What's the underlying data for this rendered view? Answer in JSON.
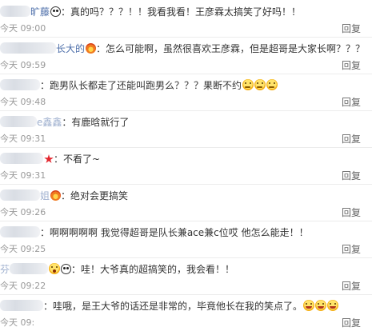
{
  "comments": [
    {
      "name": "旷藤",
      "text": "真的吗？？？！！我看我看！王彦霖太搞笑了好吗！！",
      "time": "今天 09:00",
      "reply": "回复",
      "emoji": [
        "panda-face"
      ]
    },
    {
      "name": "长大的",
      "text": "怎么可能啊，虽然很喜欢王彦霖，但是超哥是大家长啊？？？",
      "time": "今天 09:59",
      "reply": "回复",
      "emoji": [
        "fire-badge"
      ]
    },
    {
      "name": "",
      "text": "跑男队长都走了还能叫跑男么？？？果断不约",
      "time": "今天 09:48",
      "reply": "回复",
      "emoji": [
        "sweat-face",
        "sweat-face",
        "sweat-face"
      ]
    },
    {
      "name": "e鑫鑫",
      "text": "有鹿晗就行了",
      "time": "今天 09:31",
      "reply": "回复",
      "emoji": []
    },
    {
      "name": "",
      "text": "不看了~",
      "time": "今天 09:31",
      "reply": "回复",
      "emoji": [
        "red-star"
      ]
    },
    {
      "name": "姐",
      "text": "绝对会更搞笑",
      "time": "今天 09:26",
      "reply": "回复",
      "emoji": [
        "fire-badge"
      ]
    },
    {
      "name": "",
      "text": "啊啊啊啊啊  我觉得超哥是队长兼ace兼c位哎 他怎么能走！！",
      "time": "今天 09:25",
      "reply": "回复",
      "emoji": []
    },
    {
      "name": "芬",
      "text": "哇！大爷真的超搞笑的，我会看！！",
      "time": "今天 09:22",
      "reply": "回复",
      "emoji": [
        "wow-face",
        "panda-face"
      ]
    },
    {
      "name": "",
      "text": "哇哦，是王大爷的话还是非常的，毕竟他长在我的笑点了。",
      "time": "今天 09:",
      "reply": "回复",
      "emoji": [
        "laugh-face",
        "laugh-face",
        "laugh-face"
      ]
    }
  ]
}
